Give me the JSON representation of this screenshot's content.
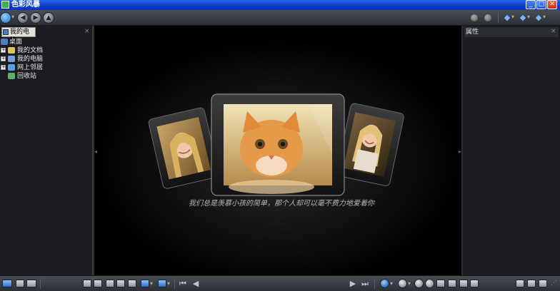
{
  "window": {
    "title": "色彩风暴",
    "minimize": "_",
    "maximize": "□",
    "close": "✕"
  },
  "toolbar": {
    "back": "◀",
    "forward": "▶",
    "up": "▲",
    "menu_arrow": "▾",
    "arrows": [
      "◆",
      "◆",
      "◆"
    ]
  },
  "left_panel": {
    "tab_label": "我的电脑",
    "close": "×",
    "tree": [
      {
        "label": "桌面",
        "expander": "",
        "color": "#4a7ec4"
      },
      {
        "label": "我的文档",
        "expander": "+",
        "color": "#e2c45a"
      },
      {
        "label": "我的电脑",
        "expander": "+",
        "color": "#6fa0d8"
      },
      {
        "label": "网上邻居",
        "expander": "+",
        "color": "#5aa0e0"
      },
      {
        "label": "回收站",
        "expander": "",
        "color": "#5ab06a"
      }
    ]
  },
  "viewer": {
    "caption": "我们总是羡慕小孩的简单，那个人却可以毫不费力地爱着你",
    "photos": [
      {
        "subject": "smiling little girl with long hair"
      },
      {
        "subject": "orange kitten"
      },
      {
        "subject": "smiling woman"
      }
    ]
  },
  "right_panel": {
    "title": "属性",
    "close": "×"
  },
  "bottombar": {
    "first": "⏮",
    "prev": "◀",
    "next": "▶",
    "last": "⏭"
  }
}
